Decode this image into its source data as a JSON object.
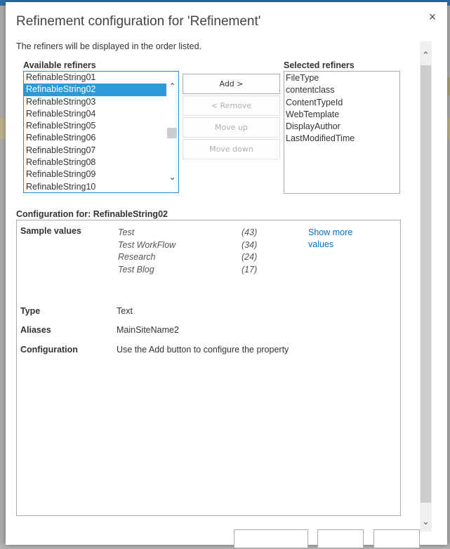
{
  "dialog": {
    "title": "Refinement configuration for 'Refinement'",
    "close_icon": "×",
    "intro_text": "The refiners will be displayed in the order listed."
  },
  "available": {
    "label": "Available refiners",
    "items": [
      "RefinableString01",
      "RefinableString02",
      "RefinableString03",
      "RefinableString04",
      "RefinableString05",
      "RefinableString06",
      "RefinableString07",
      "RefinableString08",
      "RefinableString09",
      "RefinableString10"
    ],
    "selected_index": 1,
    "scroll_up_icon": "⌃",
    "scroll_down_icon": "⌄"
  },
  "buttons": {
    "add": "Add >",
    "remove": "< Remove",
    "move_up": "Move up",
    "move_down": "Move down"
  },
  "selected": {
    "label": "Selected refiners",
    "items": [
      "FileType",
      "contentclass",
      "ContentTypeId",
      "WebTemplate",
      "DisplayAuthor",
      "LastModifiedTime"
    ]
  },
  "configuration": {
    "heading": "Configuration for: RefinableString02",
    "sample_values_label": "Sample values",
    "sample_values": [
      {
        "name": "Test",
        "count": "(43)"
      },
      {
        "name": "Test WorkFlow",
        "count": "(34)"
      },
      {
        "name": "Research",
        "count": "(24)"
      },
      {
        "name": "Test Blog",
        "count": "(17)"
      }
    ],
    "show_more": "Show more values",
    "type_label": "Type",
    "type_value": "Text",
    "aliases_label": "Aliases",
    "aliases_value": "MainSiteName2",
    "config_label": "Configuration",
    "config_value": "Use the Add button to configure the property"
  },
  "outer_scroll": {
    "up_icon": "⌃",
    "down_icon": "⌄"
  },
  "colors": {
    "accent": "#2a9ad8",
    "link": "#0072c6",
    "list_border": "#2a8dd4"
  }
}
